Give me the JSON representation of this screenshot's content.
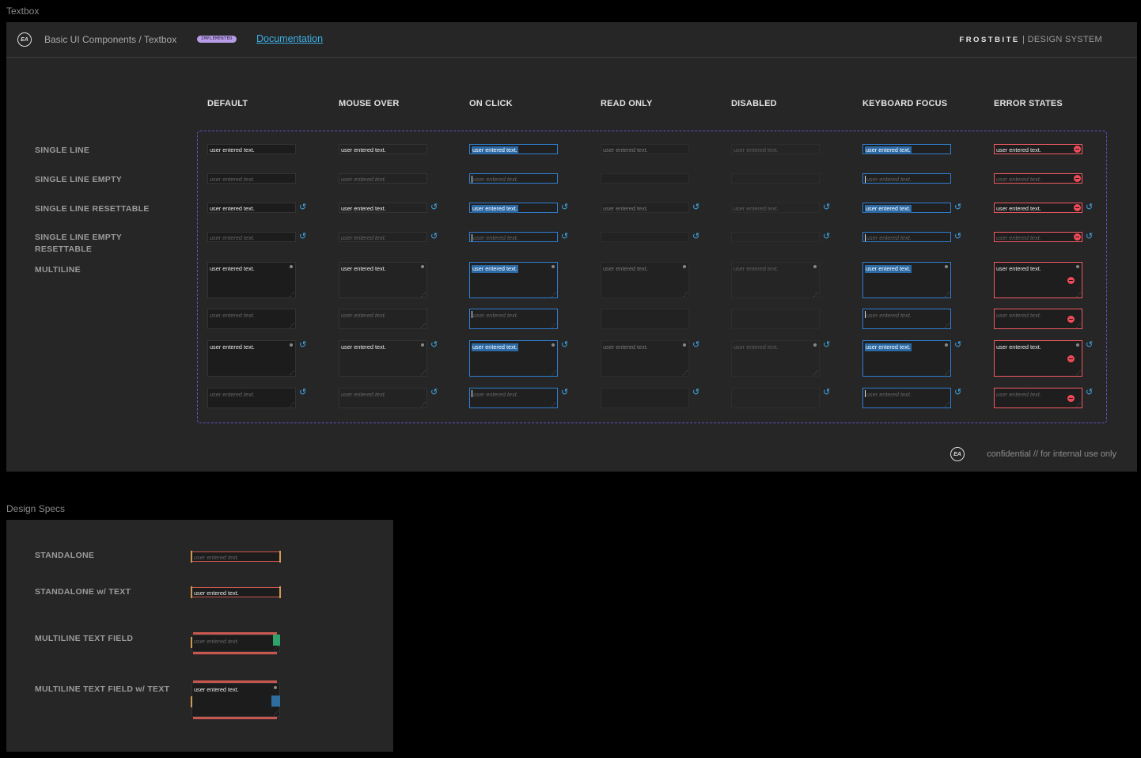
{
  "frames": {
    "textbox_title": "Textbox",
    "specs_title": "Design Specs"
  },
  "header": {
    "logo": "EA",
    "breadcrumb": "Basic UI Components / Textbox",
    "badge": "IMPLEMENTED",
    "doc_link": "Documentation",
    "brand_name": "FROSTBITE",
    "brand_sep": "|",
    "brand_sub": "DESIGN SYSTEM"
  },
  "columns": [
    "DEFAULT",
    "MOUSE OVER",
    "ON CLICK",
    "READ ONLY",
    "DISABLED",
    "KEYBOARD FOCUS",
    "ERROR STATES"
  ],
  "rows": [
    "SINGLE LINE",
    "SINGLE LINE EMPTY",
    "SINGLE LINE RESETTABLE",
    "SINGLE LINE EMPTY RESETTABLE",
    "MULTILINE"
  ],
  "sample_text": "user entered text.",
  "footer": {
    "logo": "EA",
    "confidential": "confidential // for internal use only"
  },
  "specs": {
    "rows": [
      "STANDALONE",
      "STANDALONE w/ TEXT",
      "MULTILINE TEXT FIELD",
      "MULTILINE TEXT FIELD w/ TEXT"
    ],
    "sample_text": "user entered text."
  },
  "colors": {
    "background": "#000000",
    "panel": "#262626",
    "accent_blue": "#2f7fd3",
    "error_red": "#ef5a62",
    "link": "#3db0e6",
    "badge": "#b79ce6",
    "dashed_border": "#6a4cc7"
  },
  "icons": {
    "reset": "reset-icon",
    "error": "error-icon",
    "resize": "resize-grip-icon"
  }
}
